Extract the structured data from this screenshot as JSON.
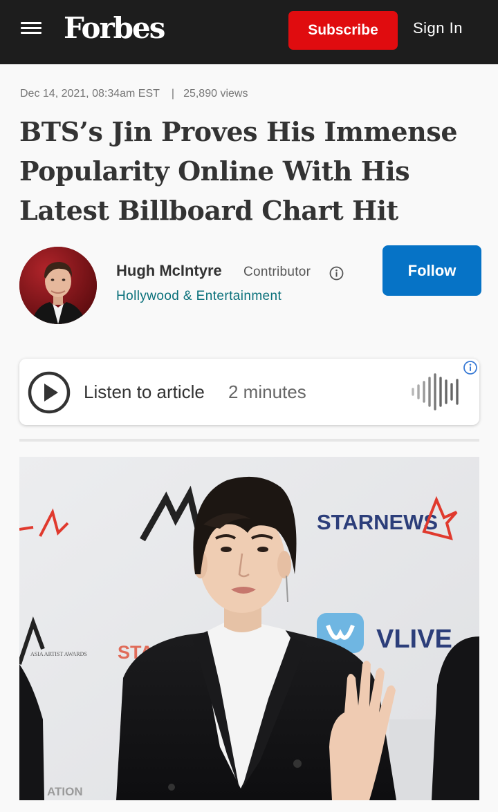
{
  "header": {
    "logo": "Forbes",
    "subscribe_label": "Subscribe",
    "signin_label": "Sign In",
    "icons": [
      "menu-icon"
    ],
    "colors": {
      "background": "#1d1d1d",
      "subscribe": "#e00c0f"
    }
  },
  "article": {
    "date": "Dec 14, 2021, 08:34am EST",
    "separator": "|",
    "views": "25,890 views",
    "headline": "BTS’s Jin Proves His Immense Popularity Online With His Latest Billboard Chart Hit"
  },
  "author": {
    "name": "Hugh McIntyre",
    "role": "Contributor",
    "section": "Hollywood & Entertainment",
    "follow_label": "Follow",
    "colors": {
      "section": "#09707a",
      "follow": "#0673c6"
    }
  },
  "listen": {
    "label": "Listen to article",
    "duration": "2 minutes",
    "icons": [
      "play-icon",
      "waveform-icon",
      "info-icon"
    ]
  },
  "hero_image": {
    "backdrop_texts": [
      "STARNEWS",
      "VLIVE",
      "ASIA ARTIST AWARDS",
      "STA",
      "ATION"
    ]
  }
}
